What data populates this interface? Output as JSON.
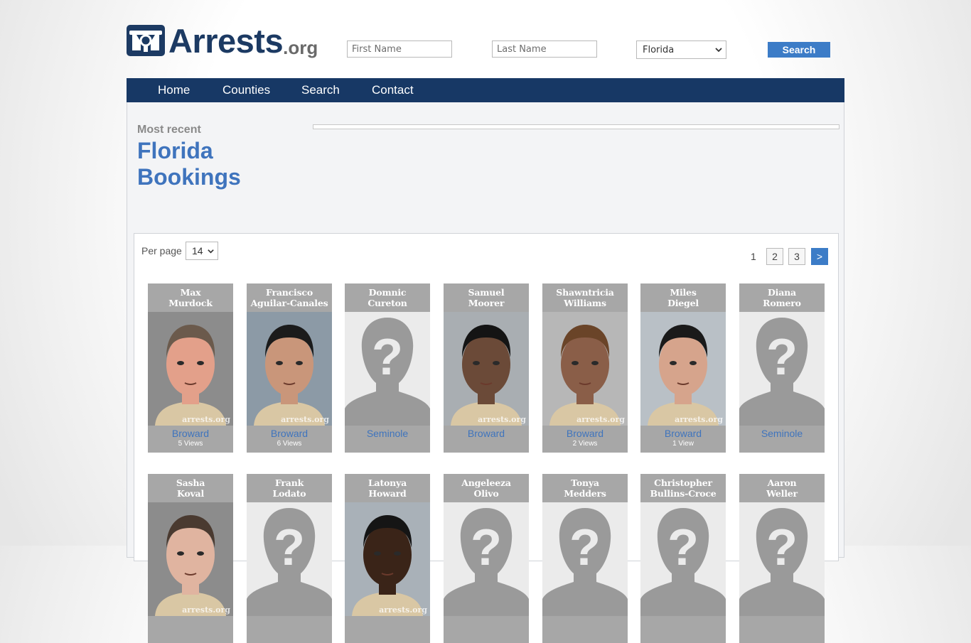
{
  "logo": {
    "word": "Arrests",
    "tld": ".org"
  },
  "search": {
    "first_name_placeholder": "First Name",
    "last_name_placeholder": "Last Name",
    "state_selected": "Florida",
    "button_label": "Search"
  },
  "nav": {
    "items": [
      "Home",
      "Counties",
      "Search",
      "Contact"
    ]
  },
  "heading": {
    "kicker": "Most recent",
    "line1": "Florida",
    "line2": "Bookings"
  },
  "listing": {
    "per_page_label": "Per page",
    "per_page_value": "14",
    "pagination": {
      "current": "1",
      "pages": [
        "2",
        "3"
      ],
      "next": ">"
    },
    "watermark": "arrests.org",
    "row1": [
      {
        "first": "Max",
        "last": "Murdock",
        "county": "Broward",
        "views": "5 Views",
        "photo": "mugshot"
      },
      {
        "first": "Francisco",
        "last": "Aguilar-Canales",
        "county": "Broward",
        "views": "6 Views",
        "photo": "mugshot"
      },
      {
        "first": "Domnic",
        "last": "Cureton",
        "county": "Seminole",
        "views": "",
        "photo": "placeholder"
      },
      {
        "first": "Samuel",
        "last": "Moorer",
        "county": "Broward",
        "views": "",
        "photo": "mugshot"
      },
      {
        "first": "Shawntricia",
        "last": "Williams",
        "county": "Broward",
        "views": "2 Views",
        "photo": "mugshot"
      },
      {
        "first": "Miles",
        "last": "Diegel",
        "county": "Broward",
        "views": "1 View",
        "photo": "mugshot"
      },
      {
        "first": "Diana",
        "last": "Romero",
        "county": "Seminole",
        "views": "",
        "photo": "placeholder"
      }
    ],
    "row2": [
      {
        "first": "Sasha",
        "last": "Koval",
        "photo": "mugshot"
      },
      {
        "first": "Frank",
        "last": "Lodato",
        "photo": "placeholder"
      },
      {
        "first": "Latonya",
        "last": "Howard",
        "photo": "mugshot"
      },
      {
        "first": "Angeleeza",
        "last": "Olivo",
        "photo": "placeholder"
      },
      {
        "first": "Tonya",
        "last": "Medders",
        "photo": "placeholder"
      },
      {
        "first": "Christopher",
        "last": "Bullins-Croce",
        "photo": "placeholder"
      },
      {
        "first": "Aaron",
        "last": "Weller",
        "photo": "placeholder"
      }
    ]
  },
  "colors": {
    "navy": "#173865",
    "accent": "#3c7cc7",
    "link": "#3f74bd",
    "card_gray": "#a7a7a7"
  }
}
